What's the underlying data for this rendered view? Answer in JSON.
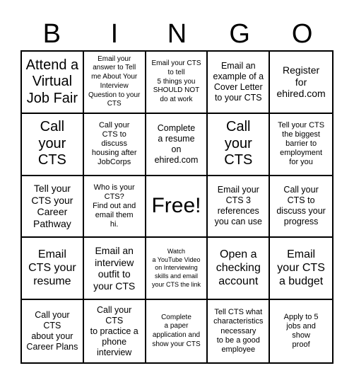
{
  "header": {
    "letters": [
      "B",
      "I",
      "N",
      "G",
      "O"
    ]
  },
  "board": {
    "rows": [
      [
        {
          "text": "Attend a\nVirtual\nJob Fair",
          "size": "xl"
        },
        {
          "text": "Email your\nanswer to Tell\nme About Your\nInterview\nQuestion to your\nCTS",
          "size": "xs"
        },
        {
          "text": "Email your CTS\nto tell\n5 things you\nSHOULD NOT\ndo at work",
          "size": "xs"
        },
        {
          "text": "Email an\nexample of a\nCover Letter\nto your CTS",
          "size": "m"
        },
        {
          "text": "Register\nfor\nehired.com",
          "size": "lm"
        }
      ],
      [
        {
          "text": "Call\nyour\nCTS",
          "size": "xl"
        },
        {
          "text": "Call your\nCTS to\ndiscuss\nhousing after\nJobCorps",
          "size": "s"
        },
        {
          "text": "Complete\na resume\non\nehired.com",
          "size": "m"
        },
        {
          "text": "Call\nyour\nCTS",
          "size": "xl"
        },
        {
          "text": "Tell your CTS\nthe biggest\nbarrier to\nemployment\nfor you",
          "size": "s"
        }
      ],
      [
        {
          "text": "Tell your\nCTS your\nCareer\nPathway",
          "size": "lm"
        },
        {
          "text": "Who is your\nCTS?\nFind out and\nemail them\nhi.",
          "size": "s"
        },
        {
          "text": "Free!",
          "size": "free"
        },
        {
          "text": "Email your\nCTS 3\nreferences\nyou can use",
          "size": "m"
        },
        {
          "text": "Call your\nCTS to\ndiscuss your\nprogress",
          "size": "m"
        }
      ],
      [
        {
          "text": "Email\nCTS your\nresume",
          "size": "l"
        },
        {
          "text": "Email an\ninterview\noutfit to\nyour CTS",
          "size": "lm"
        },
        {
          "text": "Watch\na YouTube Video\non Interviewing\nskills and email\nyour CTS the link",
          "size": "xxs"
        },
        {
          "text": "Open a\nchecking\naccount",
          "size": "l"
        },
        {
          "text": "Email\nyour CTS\na budget",
          "size": "l"
        }
      ],
      [
        {
          "text": "Call your\nCTS\nabout your\nCareer Plans",
          "size": "m"
        },
        {
          "text": "Call your\nCTS\nto practice a\nphone\ninterview",
          "size": "m"
        },
        {
          "text": "Complete\na paper\napplication and\nshow your CTS",
          "size": "xs"
        },
        {
          "text": "Tell CTS what\ncharacteristics\nnecessary\nto be a good\nemployee",
          "size": "s"
        },
        {
          "text": "Apply to 5\njobs and\nshow\nproof",
          "size": "s"
        }
      ]
    ]
  }
}
